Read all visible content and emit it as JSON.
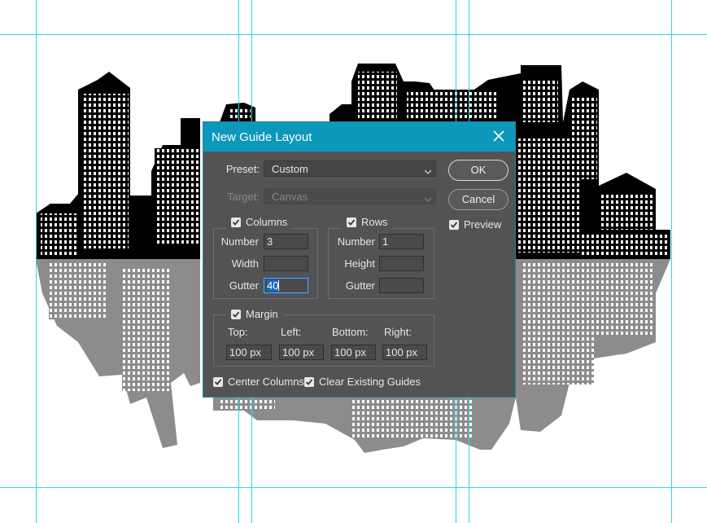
{
  "dialog": {
    "title": "New Guide Layout",
    "close_icon": "close-icon",
    "preset_label": "Preset:",
    "preset_value": "Custom",
    "target_label": "Target:",
    "target_value": "Canvas",
    "ok_label": "OK",
    "cancel_label": "Cancel",
    "preview_label": "Preview",
    "preview_checked": true,
    "columns": {
      "label": "Columns",
      "checked": true,
      "number_label": "Number",
      "number_value": "3",
      "width_label": "Width",
      "width_value": "",
      "gutter_label": "Gutter",
      "gutter_value": "40"
    },
    "rows": {
      "label": "Rows",
      "checked": true,
      "number_label": "Number",
      "number_value": "1",
      "height_label": "Height",
      "height_value": "",
      "gutter_label": "Gutter",
      "gutter_value": ""
    },
    "margin": {
      "label": "Margin",
      "checked": true,
      "top_label": "Top:",
      "left_label": "Left:",
      "bottom_label": "Bottom:",
      "right_label": "Right:",
      "top_value": "100 px",
      "left_value": "100 px",
      "bottom_value": "100 px",
      "right_value": "100 px"
    },
    "center_columns_label": "Center Columns",
    "center_columns_checked": true,
    "clear_guides_label": "Clear Existing Guides",
    "clear_guides_checked": true
  },
  "colors": {
    "guide": "#35d6df",
    "titlebar": "#0c98bb",
    "dialog_bg": "#535353",
    "city_foreground": "#000000",
    "city_reflection": "#8c8c8c"
  }
}
